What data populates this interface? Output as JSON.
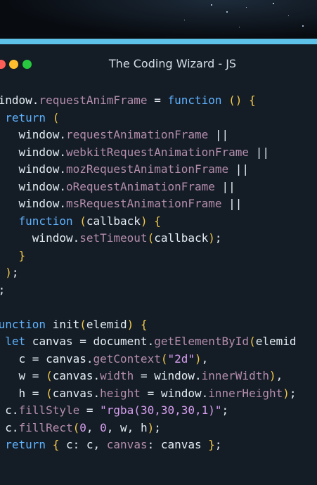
{
  "window": {
    "title": "The Coding Wizard - JS"
  },
  "colors": {
    "accent": "#5ec2e8",
    "keyword": "#5fb3ff",
    "method": "#b48ead",
    "string": "#d8a0f0",
    "paren": "#f2c94c",
    "text": "#e6edf3",
    "background": "#141c26"
  },
  "code": {
    "lines": [
      [
        {
          "t": "plain",
          "v": "window."
        },
        {
          "t": "fn",
          "v": "requestAnimFrame"
        },
        {
          "t": "plain",
          "v": " = "
        },
        {
          "t": "kw",
          "v": "function"
        },
        {
          "t": "plain",
          "v": " "
        },
        {
          "t": "pn",
          "v": "()"
        },
        {
          "t": "plain",
          "v": " "
        },
        {
          "t": "pn",
          "v": "{"
        }
      ],
      [
        {
          "t": "plain",
          "v": "  "
        },
        {
          "t": "kw",
          "v": "return"
        },
        {
          "t": "plain",
          "v": " "
        },
        {
          "t": "pn",
          "v": "("
        }
      ],
      [
        {
          "t": "plain",
          "v": "    window."
        },
        {
          "t": "fn",
          "v": "requestAnimationFrame"
        },
        {
          "t": "plain",
          "v": " ||"
        }
      ],
      [
        {
          "t": "plain",
          "v": "    window."
        },
        {
          "t": "fn",
          "v": "webkitRequestAnimationFrame"
        },
        {
          "t": "plain",
          "v": " ||"
        }
      ],
      [
        {
          "t": "plain",
          "v": "    window."
        },
        {
          "t": "fn",
          "v": "mozRequestAnimationFrame"
        },
        {
          "t": "plain",
          "v": " ||"
        }
      ],
      [
        {
          "t": "plain",
          "v": "    window."
        },
        {
          "t": "fn",
          "v": "oRequestAnimationFrame"
        },
        {
          "t": "plain",
          "v": " ||"
        }
      ],
      [
        {
          "t": "plain",
          "v": "    window."
        },
        {
          "t": "fn",
          "v": "msRequestAnimationFrame"
        },
        {
          "t": "plain",
          "v": " ||"
        }
      ],
      [
        {
          "t": "plain",
          "v": "    "
        },
        {
          "t": "kw",
          "v": "function"
        },
        {
          "t": "plain",
          "v": " "
        },
        {
          "t": "pn",
          "v": "("
        },
        {
          "t": "plain",
          "v": "callback"
        },
        {
          "t": "pn",
          "v": ")"
        },
        {
          "t": "plain",
          "v": " "
        },
        {
          "t": "pn",
          "v": "{"
        }
      ],
      [
        {
          "t": "plain",
          "v": "      window."
        },
        {
          "t": "fn",
          "v": "setTimeout"
        },
        {
          "t": "pn",
          "v": "("
        },
        {
          "t": "plain",
          "v": "callback"
        },
        {
          "t": "pn",
          "v": ")"
        },
        {
          "t": "plain",
          "v": ";"
        }
      ],
      [
        {
          "t": "plain",
          "v": "    "
        },
        {
          "t": "pn",
          "v": "}"
        }
      ],
      [
        {
          "t": "plain",
          "v": "  "
        },
        {
          "t": "pn",
          "v": ")"
        },
        {
          "t": "plain",
          "v": ";"
        }
      ],
      [
        {
          "t": "pn",
          "v": "}"
        },
        {
          "t": "plain",
          "v": ";"
        }
      ],
      [],
      [
        {
          "t": "kw",
          "v": "function"
        },
        {
          "t": "plain",
          "v": " init"
        },
        {
          "t": "pn",
          "v": "("
        },
        {
          "t": "plain",
          "v": "elemid"
        },
        {
          "t": "pn",
          "v": ")"
        },
        {
          "t": "plain",
          "v": " "
        },
        {
          "t": "pn",
          "v": "{"
        }
      ],
      [
        {
          "t": "plain",
          "v": "  "
        },
        {
          "t": "kw",
          "v": "let"
        },
        {
          "t": "plain",
          "v": " canvas = document."
        },
        {
          "t": "fn",
          "v": "getElementById"
        },
        {
          "t": "pn",
          "v": "("
        },
        {
          "t": "plain",
          "v": "elemid"
        }
      ],
      [
        {
          "t": "plain",
          "v": "    c = canvas."
        },
        {
          "t": "fn",
          "v": "getContext"
        },
        {
          "t": "pn",
          "v": "("
        },
        {
          "t": "str",
          "v": "\"2d\""
        },
        {
          "t": "pn",
          "v": ")"
        },
        {
          "t": "plain",
          "v": ","
        }
      ],
      [
        {
          "t": "plain",
          "v": "    w = "
        },
        {
          "t": "pn",
          "v": "("
        },
        {
          "t": "plain",
          "v": "canvas."
        },
        {
          "t": "fn",
          "v": "width"
        },
        {
          "t": "plain",
          "v": " = window."
        },
        {
          "t": "fn",
          "v": "innerWidth"
        },
        {
          "t": "pn",
          "v": ")"
        },
        {
          "t": "plain",
          "v": ","
        }
      ],
      [
        {
          "t": "plain",
          "v": "    h = "
        },
        {
          "t": "pn",
          "v": "("
        },
        {
          "t": "plain",
          "v": "canvas."
        },
        {
          "t": "fn",
          "v": "height"
        },
        {
          "t": "plain",
          "v": " = window."
        },
        {
          "t": "fn",
          "v": "innerHeight"
        },
        {
          "t": "pn",
          "v": ")"
        },
        {
          "t": "plain",
          "v": ";"
        }
      ],
      [
        {
          "t": "plain",
          "v": "  c."
        },
        {
          "t": "fn",
          "v": "fillStyle"
        },
        {
          "t": "plain",
          "v": " = "
        },
        {
          "t": "str",
          "v": "\"rgba(30,30,30,1)\""
        },
        {
          "t": "plain",
          "v": ";"
        }
      ],
      [
        {
          "t": "plain",
          "v": "  c."
        },
        {
          "t": "fn",
          "v": "fillRect"
        },
        {
          "t": "pn",
          "v": "("
        },
        {
          "t": "num",
          "v": "0"
        },
        {
          "t": "plain",
          "v": ", "
        },
        {
          "t": "num",
          "v": "0"
        },
        {
          "t": "plain",
          "v": ", w, h"
        },
        {
          "t": "pn",
          "v": ")"
        },
        {
          "t": "plain",
          "v": ";"
        }
      ],
      [
        {
          "t": "plain",
          "v": "  "
        },
        {
          "t": "kw",
          "v": "return"
        },
        {
          "t": "plain",
          "v": " "
        },
        {
          "t": "pn",
          "v": "{"
        },
        {
          "t": "plain",
          "v": " c: c, "
        },
        {
          "t": "fn",
          "v": "canvas"
        },
        {
          "t": "plain",
          "v": ": canvas "
        },
        {
          "t": "pn",
          "v": "}"
        },
        {
          "t": "plain",
          "v": ";"
        }
      ]
    ]
  }
}
